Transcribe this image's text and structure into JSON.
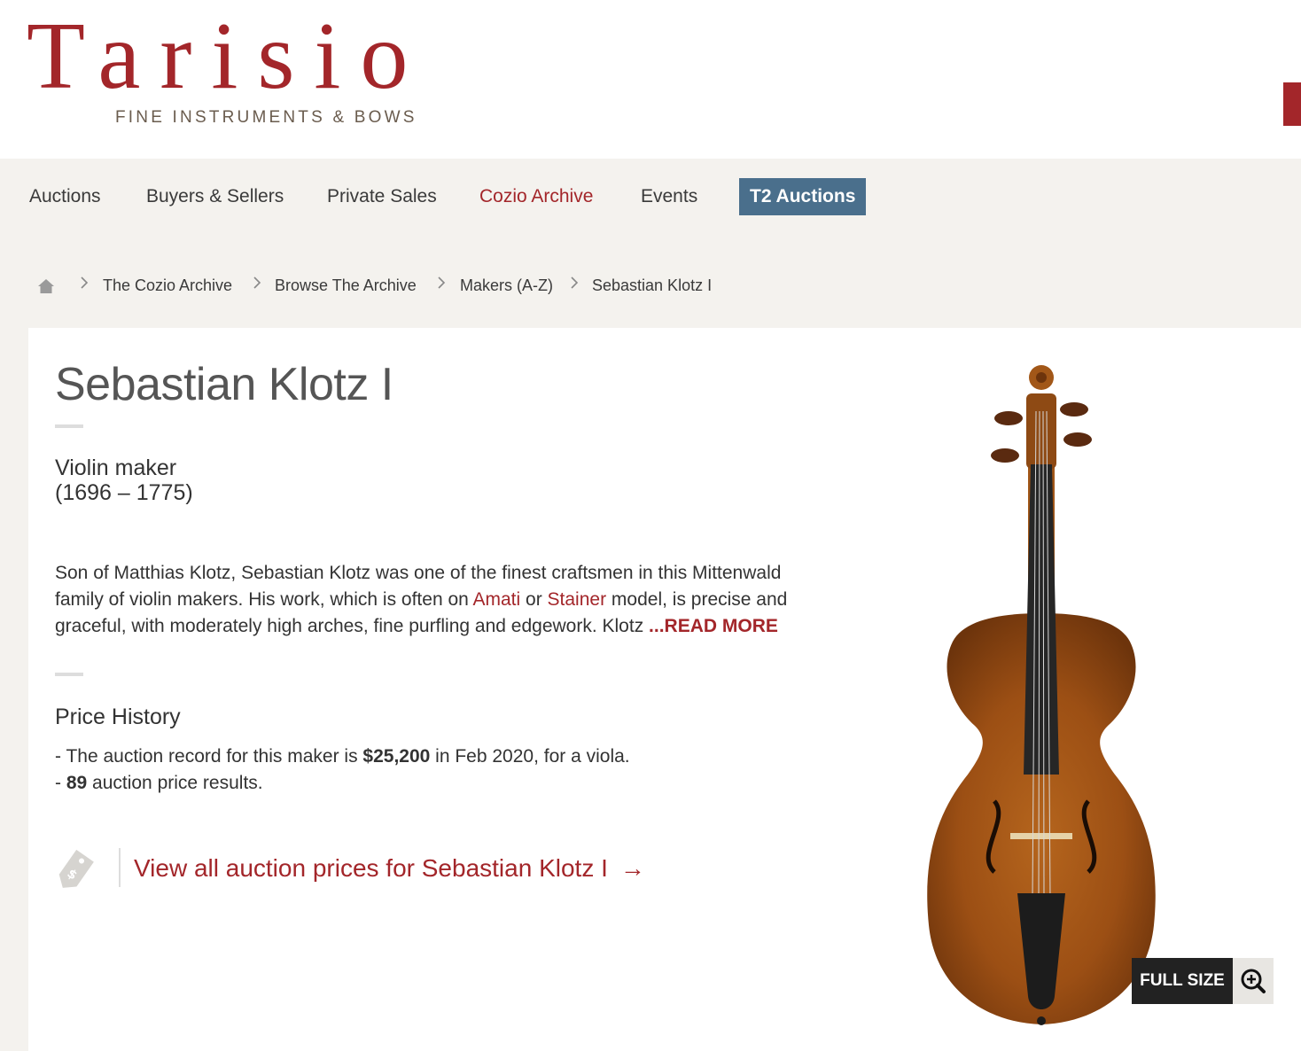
{
  "header": {
    "logo_name": "Tarisio",
    "logo_tagline": "FINE INSTRUMENTS & BOWS"
  },
  "nav": {
    "items": [
      {
        "label": "Auctions"
      },
      {
        "label": "Buyers & Sellers"
      },
      {
        "label": "Private Sales"
      },
      {
        "label": "Cozio Archive",
        "active": true
      },
      {
        "label": "Events"
      },
      {
        "label": "T2 Auctions",
        "highlight": true
      }
    ]
  },
  "breadcrumb": {
    "items": [
      "The Cozio Archive",
      "Browse The Archive",
      "Makers (A-Z)",
      "Sebastian Klotz I"
    ]
  },
  "maker": {
    "name": "Sebastian Klotz I",
    "role": "Violin maker",
    "dates": "(1696 – 1775)",
    "bio": {
      "part1": "Son of Matthias Klotz, Sebastian Klotz was one of the finest craftsmen in this Mittenwald family of violin makers. His work, which is often on ",
      "link1": "Amati",
      "part2": " or ",
      "link2": "Stainer",
      "part3": " model, is precise and graceful, with moderately high arches, fine purfling and edgework. Klotz ",
      "read_more": "...READ MORE"
    }
  },
  "price_history": {
    "title": "Price History",
    "record_prefix": "- The auction record for this maker is ",
    "record_value": "$25,200",
    "record_suffix": " in Feb 2020, for a viola.",
    "count_prefix": "- ",
    "count_value": "89",
    "count_suffix": " auction price results."
  },
  "view_all": {
    "label": "View all auction prices for Sebastian Klotz I",
    "arrow": "→"
  },
  "image_controls": {
    "full_size_label": "FULL SIZE"
  },
  "colors": {
    "brand_red": "#a3262a",
    "nav_highlight": "#4a6f8c",
    "page_bg": "#f4f2ee"
  },
  "icons": [
    "home-icon",
    "chevron-right-icon",
    "price-tag-icon",
    "arrow-right-icon",
    "zoom-in-icon"
  ]
}
